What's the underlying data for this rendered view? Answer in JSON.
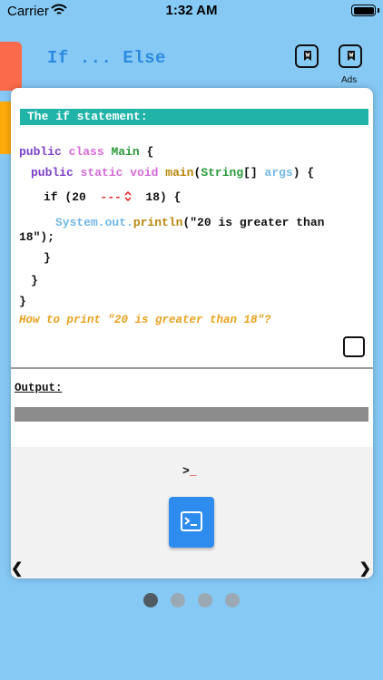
{
  "status": {
    "carrier": "Carrier",
    "time": "1:32 AM"
  },
  "header": {
    "title": "If ... Else",
    "ads_label": "Ads"
  },
  "lesson": {
    "section_title": "The if statement:",
    "code": {
      "l1_kw": "public",
      "l1_kw2": "class",
      "l1_name": "Main",
      "l1_brace": " {",
      "l2_kw": "public",
      "l2_kw2": "static",
      "l2_kw3": "void",
      "l2_fn": "main",
      "l2_open": "(",
      "l2_type": "String",
      "l2_arr": "[] ",
      "l2_param": "args",
      "l2_close": ") {",
      "l3_if": "if (20  ",
      "l3_blank": "---",
      "l3_rest": "  18) {",
      "l4_obj": "System.out.",
      "l4_fn": "println",
      "l4_str": "(\"20 is greater than",
      "l5_str": "18\");",
      "l6": "}",
      "l7": "}",
      "l8": "}"
    },
    "question": "How to print \"20 is greater than 18\"?",
    "output_label": "Output:"
  },
  "console": {
    "prompt": ">",
    "cursor": "_"
  },
  "nav": {
    "prev": "❮",
    "next": "❯"
  },
  "pager": {
    "total": 4,
    "current": 1
  },
  "colors": {
    "background": "#86c9f5",
    "accent": "#20b4a8",
    "button": "#2f8cef",
    "question": "#e8a21f"
  }
}
